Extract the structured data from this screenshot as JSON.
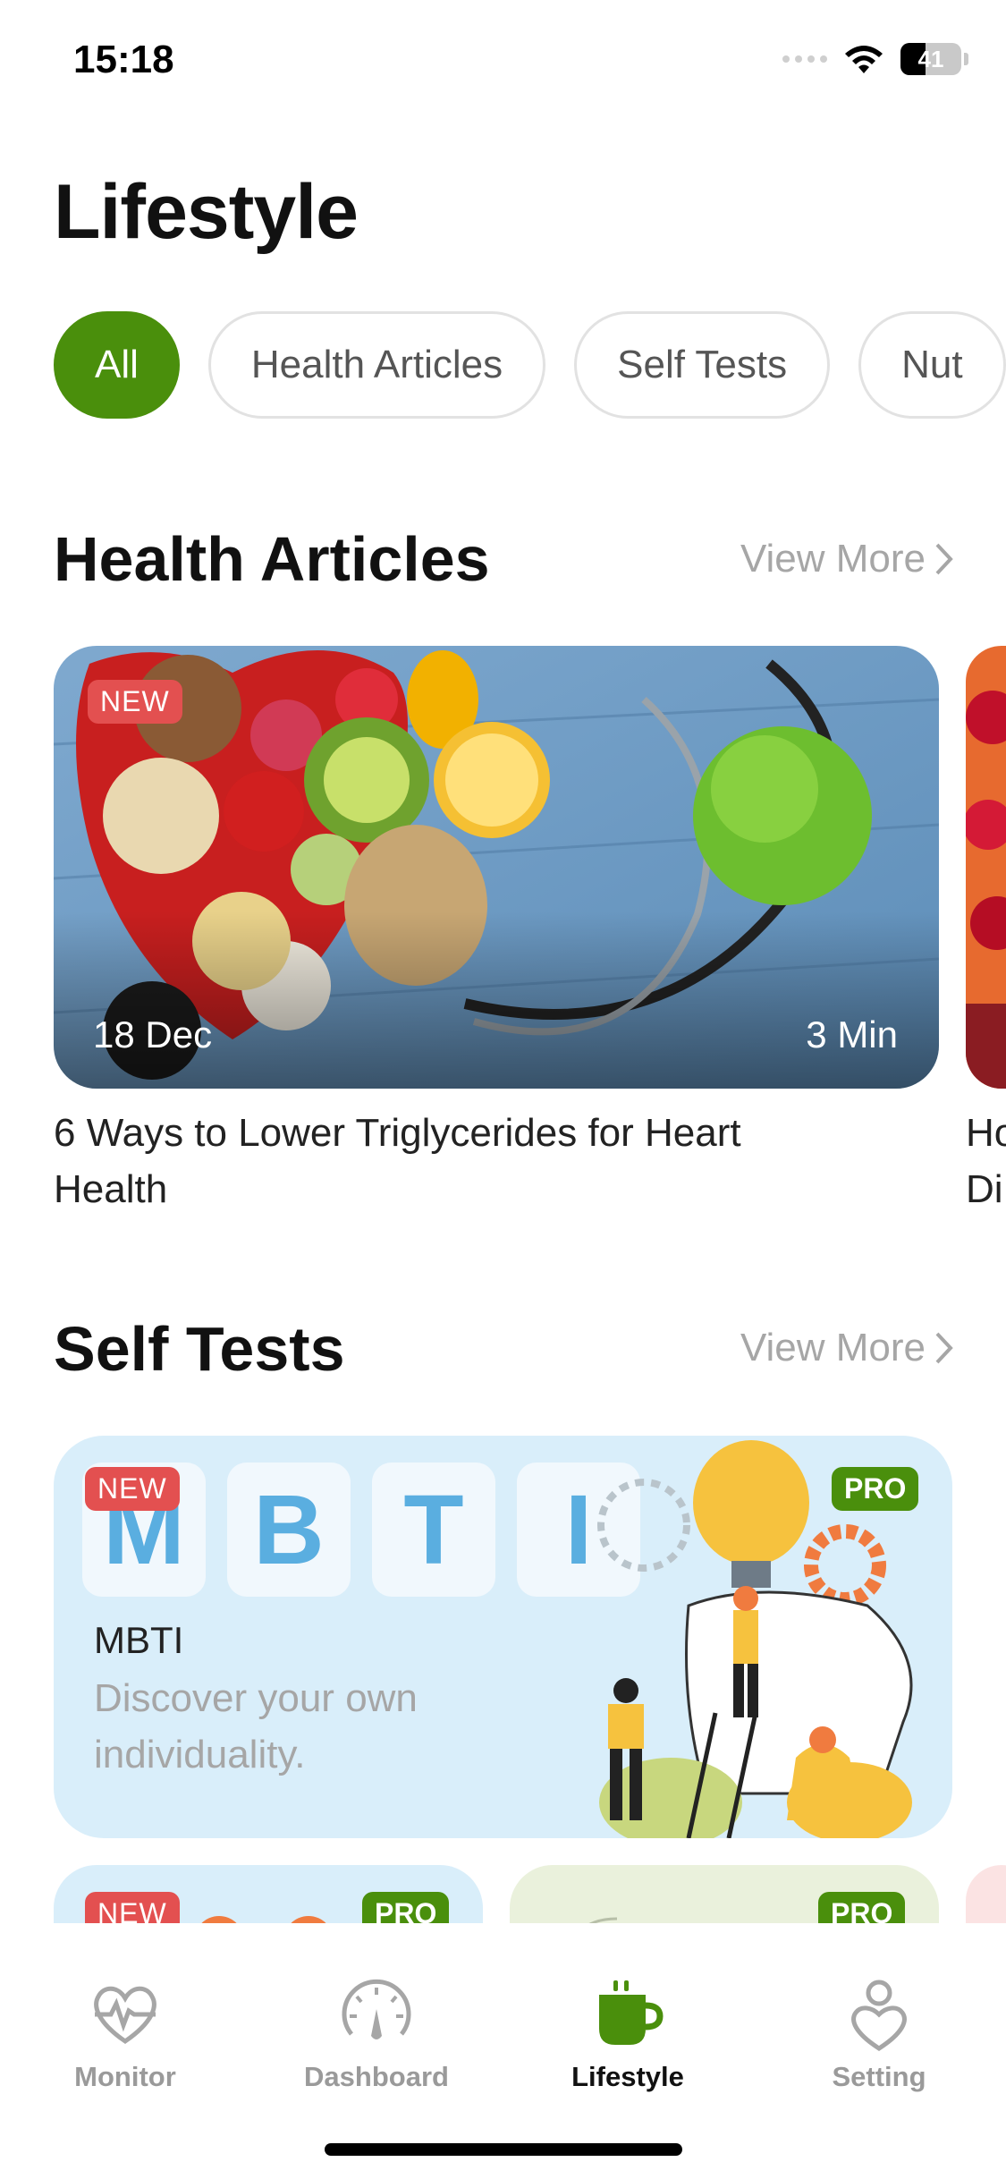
{
  "status": {
    "time": "15:18",
    "battery": "41",
    "battery_level": 0.41
  },
  "page_title": "Lifestyle",
  "chips": [
    "All",
    "Health Articles",
    "Self Tests",
    "Nut"
  ],
  "health_articles": {
    "title": "Health Articles",
    "view_more": "View More",
    "card": {
      "badge": "NEW",
      "date": "18 Dec",
      "duration": "3 Min",
      "title": "6 Ways to Lower Triglycerides for Heart Health"
    },
    "peek_title": "Ho\nDi"
  },
  "self_tests": {
    "title": "Self Tests",
    "view_more": "View More",
    "card": {
      "badge_new": "NEW",
      "badge_pro": "PRO",
      "letters": [
        "M",
        "B",
        "T",
        "I"
      ],
      "name": "MBTI",
      "description": "Discover your own individuality."
    },
    "small_cards": [
      {
        "badge_new": "NEW",
        "badge_pro": "PRO"
      },
      {
        "badge_pro": "PRO"
      }
    ]
  },
  "nav": [
    {
      "label": "Monitor",
      "icon": "heart-pulse-icon"
    },
    {
      "label": "Dashboard",
      "icon": "gauge-icon"
    },
    {
      "label": "Lifestyle",
      "icon": "coffee-cup-icon",
      "active": true
    },
    {
      "label": "Setting",
      "icon": "person-icon"
    }
  ],
  "colors": {
    "accent": "#4a8f0c",
    "badge_new": "#e35050",
    "muted": "#a6a6a6"
  }
}
